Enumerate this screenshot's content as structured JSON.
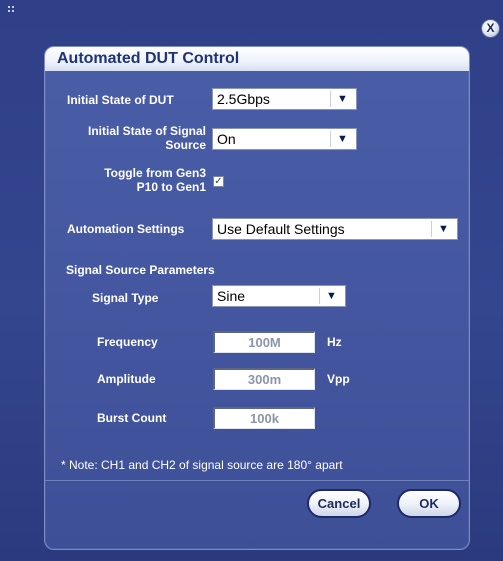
{
  "window": {
    "close_label": "X"
  },
  "dialog": {
    "title": "Automated DUT Control"
  },
  "fields": {
    "initial_state_dut": {
      "label": "Initial State of DUT",
      "value": "2.5Gbps"
    },
    "initial_state_signal_source": {
      "label_line1": "Initial State of Signal",
      "label_line2": "Source",
      "value": "On"
    },
    "toggle_gen3_to_gen1": {
      "label_line1": "Toggle from Gen3",
      "label_line2": "P10 to Gen1",
      "checked": true,
      "check_glyph": "✓"
    },
    "automation_settings": {
      "label": "Automation Settings",
      "value": "Use Default Settings"
    }
  },
  "signal_source_params": {
    "section_label": "Signal Source Parameters",
    "signal_type": {
      "label": "Signal Type",
      "value": "Sine"
    },
    "frequency": {
      "label": "Frequency",
      "value": "100M",
      "unit": "Hz"
    },
    "amplitude": {
      "label": "Amplitude",
      "value": "300m",
      "unit": "Vpp"
    },
    "burst_count": {
      "label": "Burst Count",
      "value": "100k"
    }
  },
  "note": "* Note: CH1 and CH2 of signal source are 180° apart",
  "buttons": {
    "cancel": "Cancel",
    "ok": "OK"
  },
  "icons": {
    "dropdown_arrow": "▼"
  },
  "colors": {
    "background": "#33468e",
    "panel": "#4458a2",
    "title_text": "#1f3478",
    "button_border": "#1d2a68"
  }
}
